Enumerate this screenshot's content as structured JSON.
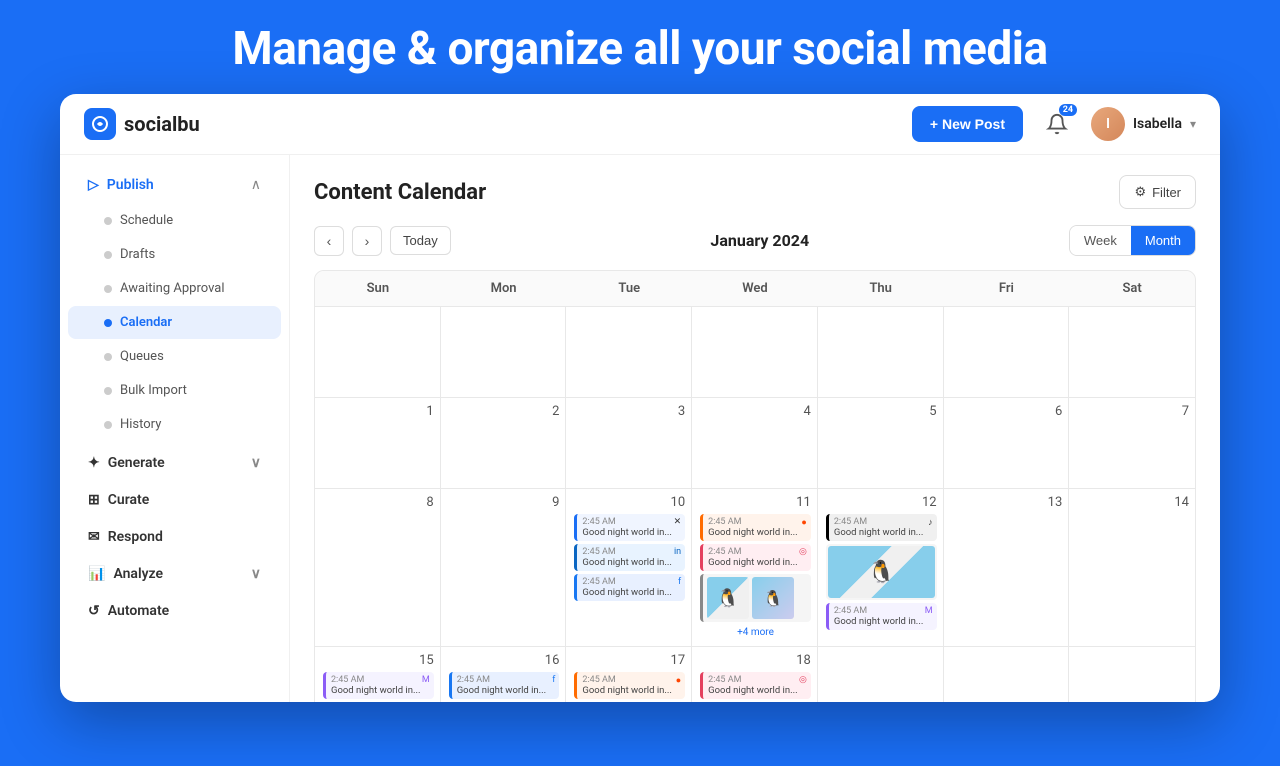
{
  "hero": {
    "title": "Manage & organize all your social media"
  },
  "topbar": {
    "logo_text": "socialbu",
    "new_post_label": "+ New Post",
    "notif_count": "24",
    "user_name": "Isabella",
    "user_initial": "I"
  },
  "sidebar": {
    "publish_label": "Publish",
    "items": [
      {
        "id": "schedule",
        "label": "Schedule"
      },
      {
        "id": "drafts",
        "label": "Drafts"
      },
      {
        "id": "awaiting",
        "label": "Awaiting Approval"
      },
      {
        "id": "calendar",
        "label": "Calendar",
        "active": true
      },
      {
        "id": "queues",
        "label": "Queues"
      },
      {
        "id": "bulk-import",
        "label": "Bulk Import"
      },
      {
        "id": "history",
        "label": "History"
      }
    ],
    "other_sections": [
      {
        "id": "generate",
        "label": "Generate",
        "has_arrow": true
      },
      {
        "id": "curate",
        "label": "Curate"
      },
      {
        "id": "respond",
        "label": "Respond"
      },
      {
        "id": "analyze",
        "label": "Analyze",
        "has_arrow": true
      },
      {
        "id": "automate",
        "label": "Automate"
      }
    ]
  },
  "calendar": {
    "title": "Content Calendar",
    "filter_label": "Filter",
    "today_label": "Today",
    "month_title": "January 2024",
    "view_week": "Week",
    "view_month": "Month",
    "days": [
      "Sun",
      "Mon",
      "Tue",
      "Wed",
      "Thu",
      "Fri",
      "Sat"
    ],
    "weeks": [
      {
        "cells": [
          {
            "date": "",
            "posts": []
          },
          {
            "date": "",
            "posts": []
          },
          {
            "date": "",
            "posts": []
          },
          {
            "date": "",
            "posts": []
          },
          {
            "date": "",
            "posts": []
          },
          {
            "date": "",
            "posts": []
          },
          {
            "date": "",
            "posts": []
          }
        ]
      },
      {
        "cells": [
          {
            "date": "",
            "posts": []
          },
          {
            "date": "",
            "posts": []
          },
          {
            "date": "",
            "posts": []
          },
          {
            "date": "",
            "posts": []
          },
          {
            "date": "",
            "posts": []
          },
          {
            "date": "",
            "posts": []
          },
          {
            "date": "",
            "posts": []
          }
        ]
      }
    ],
    "more_label": "+4 more",
    "post_time": "2:45 AM",
    "post_text": "Good night world in..."
  },
  "colors": {
    "brand": "#1a6ef5",
    "orange": "#ff6b00",
    "purple": "#8b5cf6"
  }
}
